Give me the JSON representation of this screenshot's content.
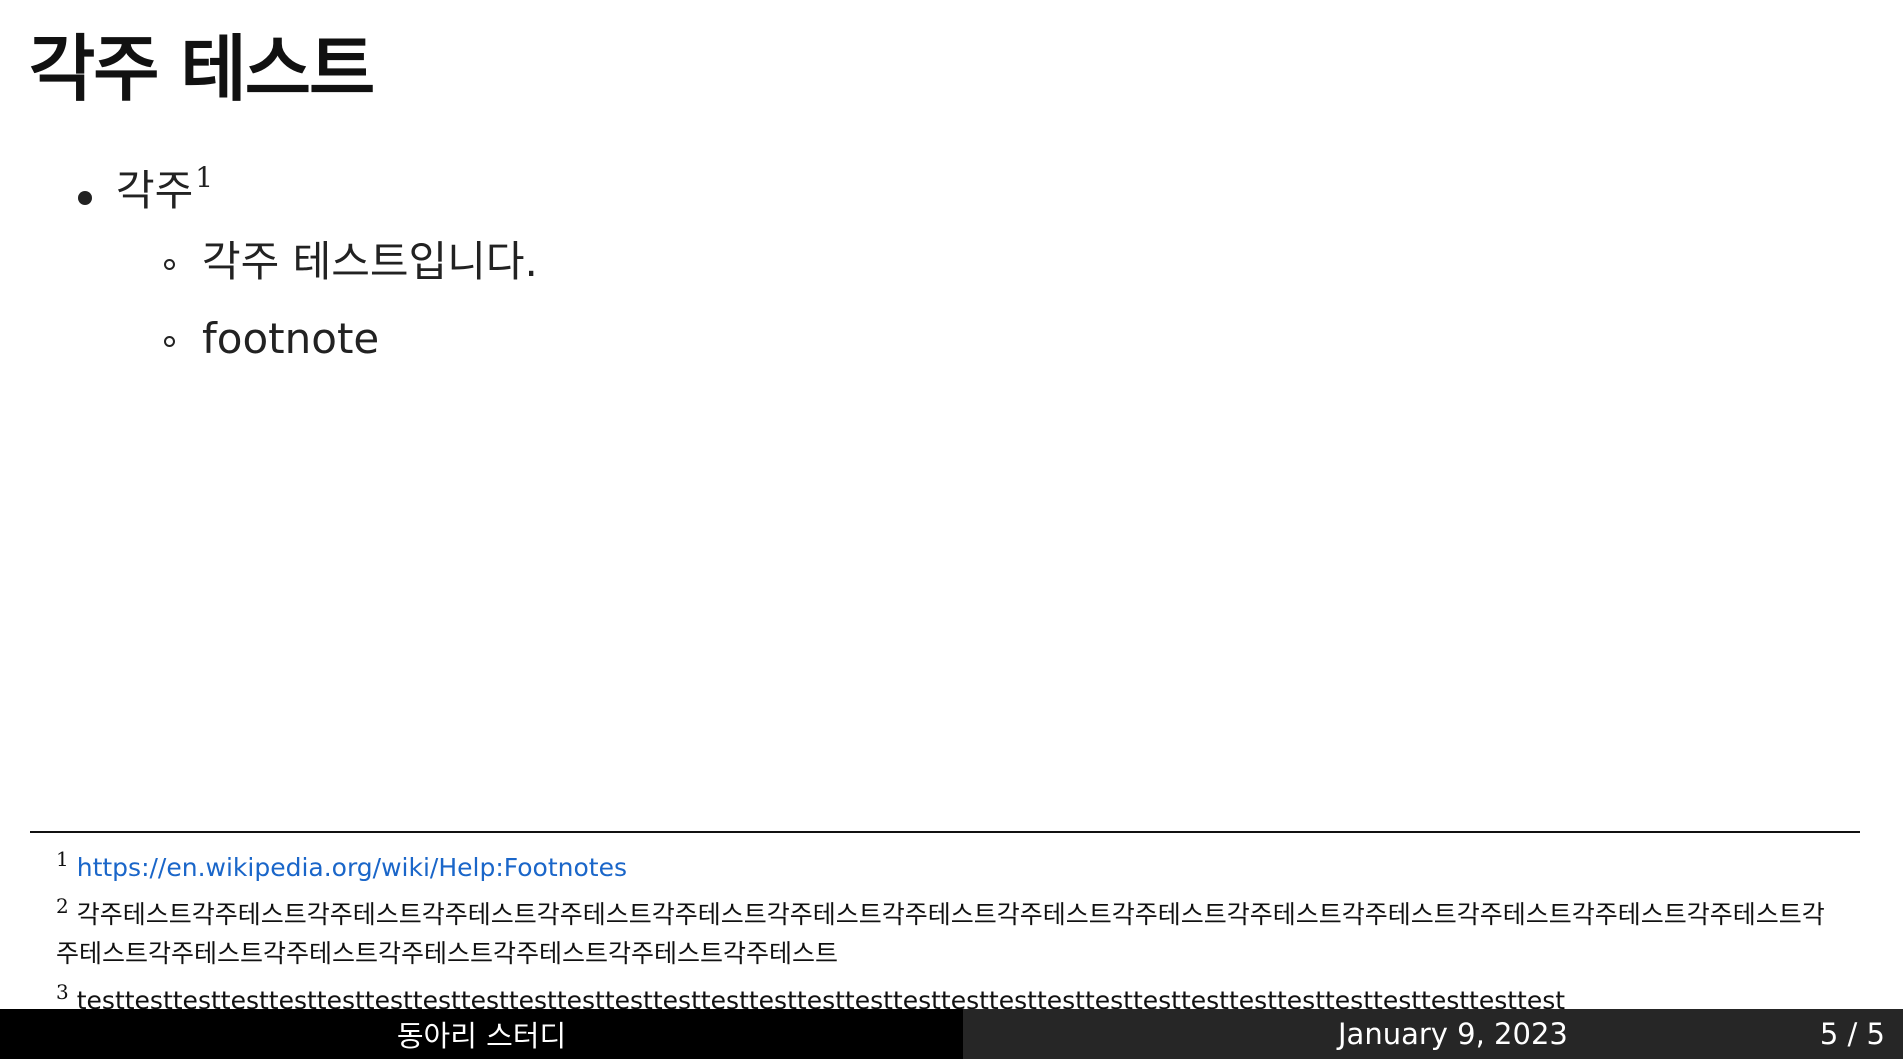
{
  "slide": {
    "title": "각주 테스트",
    "bullets": [
      {
        "text": "각주",
        "footnote_ref": "1",
        "subitems": [
          "각주 테스트입니다.",
          "footnote"
        ]
      }
    ]
  },
  "footnotes": [
    {
      "num": "1",
      "text": "https://en.wikipedia.org/wiki/Help:Footnotes",
      "is_link": true
    },
    {
      "num": "2",
      "text": "각주테스트각주테스트각주테스트각주테스트각주테스트각주테스트각주테스트각주테스트각주테스트각주테스트각주테스트각주테스트각주테스트각주테스트각주테스트각주테스트각주테스트각주테스트각주테스트각주테스트각주테스트각주테스트",
      "is_link": false
    },
    {
      "num": "3",
      "text": "testtesttesttesttesttesttesttesttesttesttesttesttesttesttesttesttesttesttesttesttesttesttesttesttesttesttesttesttesttesttest",
      "is_link": false
    }
  ],
  "footer": {
    "author": "동아리 스터디",
    "date": "January 9, 2023",
    "page": "5 / 5"
  },
  "colors": {
    "link": "#1a66c9",
    "footer_left_bg": "#000000",
    "footer_right_bg": "#262626"
  }
}
